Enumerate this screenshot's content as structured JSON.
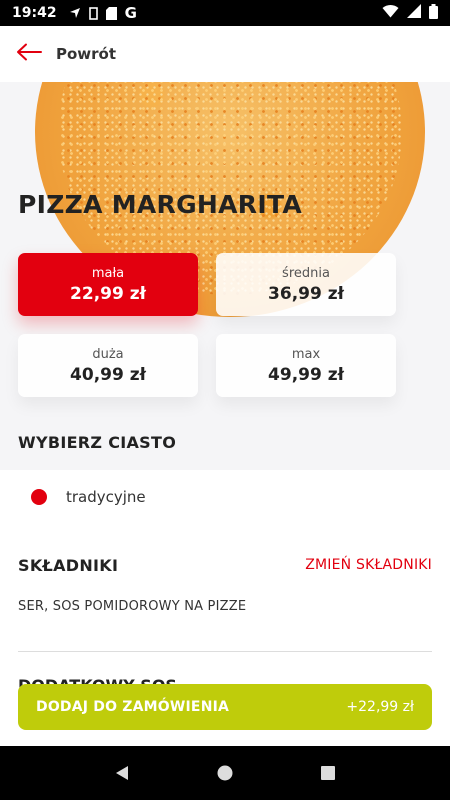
{
  "status_bar": {
    "time": "19:42",
    "icons_left": [
      "navigation-arrow-icon",
      "sim-icon",
      "sd-card-icon",
      "google-icon"
    ],
    "google_letter": "G",
    "icons_right": [
      "wifi-icon",
      "signal-icon",
      "battery-icon"
    ]
  },
  "header": {
    "back_label": "Powrót",
    "back_icon": "arrow-left-icon"
  },
  "product": {
    "title": "PIZZA MARGHARITA",
    "sizes": [
      {
        "name": "mała",
        "price": "22,99 zł",
        "selected": true
      },
      {
        "name": "średnia",
        "price": "36,99 zł",
        "selected": false
      },
      {
        "name": "duża",
        "price": "40,99 zł",
        "selected": false
      },
      {
        "name": "max",
        "price": "49,99 zł",
        "selected": false
      }
    ]
  },
  "dough": {
    "title": "WYBIERZ CIASTO",
    "option": "tradycyjne"
  },
  "ingredients": {
    "title": "SKŁADNIKI",
    "change_label": "ZMIEŃ SKŁADNIKI",
    "text": "SER, SOS POMIDOROWY NA PIZZE"
  },
  "extras": {
    "title_partial": "DODATKOWY SOS"
  },
  "add_button": {
    "label": "DODAJ DO ZAMÓWIENIA",
    "price": "+22,99 zł"
  },
  "colors": {
    "accent": "#e2000f",
    "cta": "#bfcc0b"
  }
}
